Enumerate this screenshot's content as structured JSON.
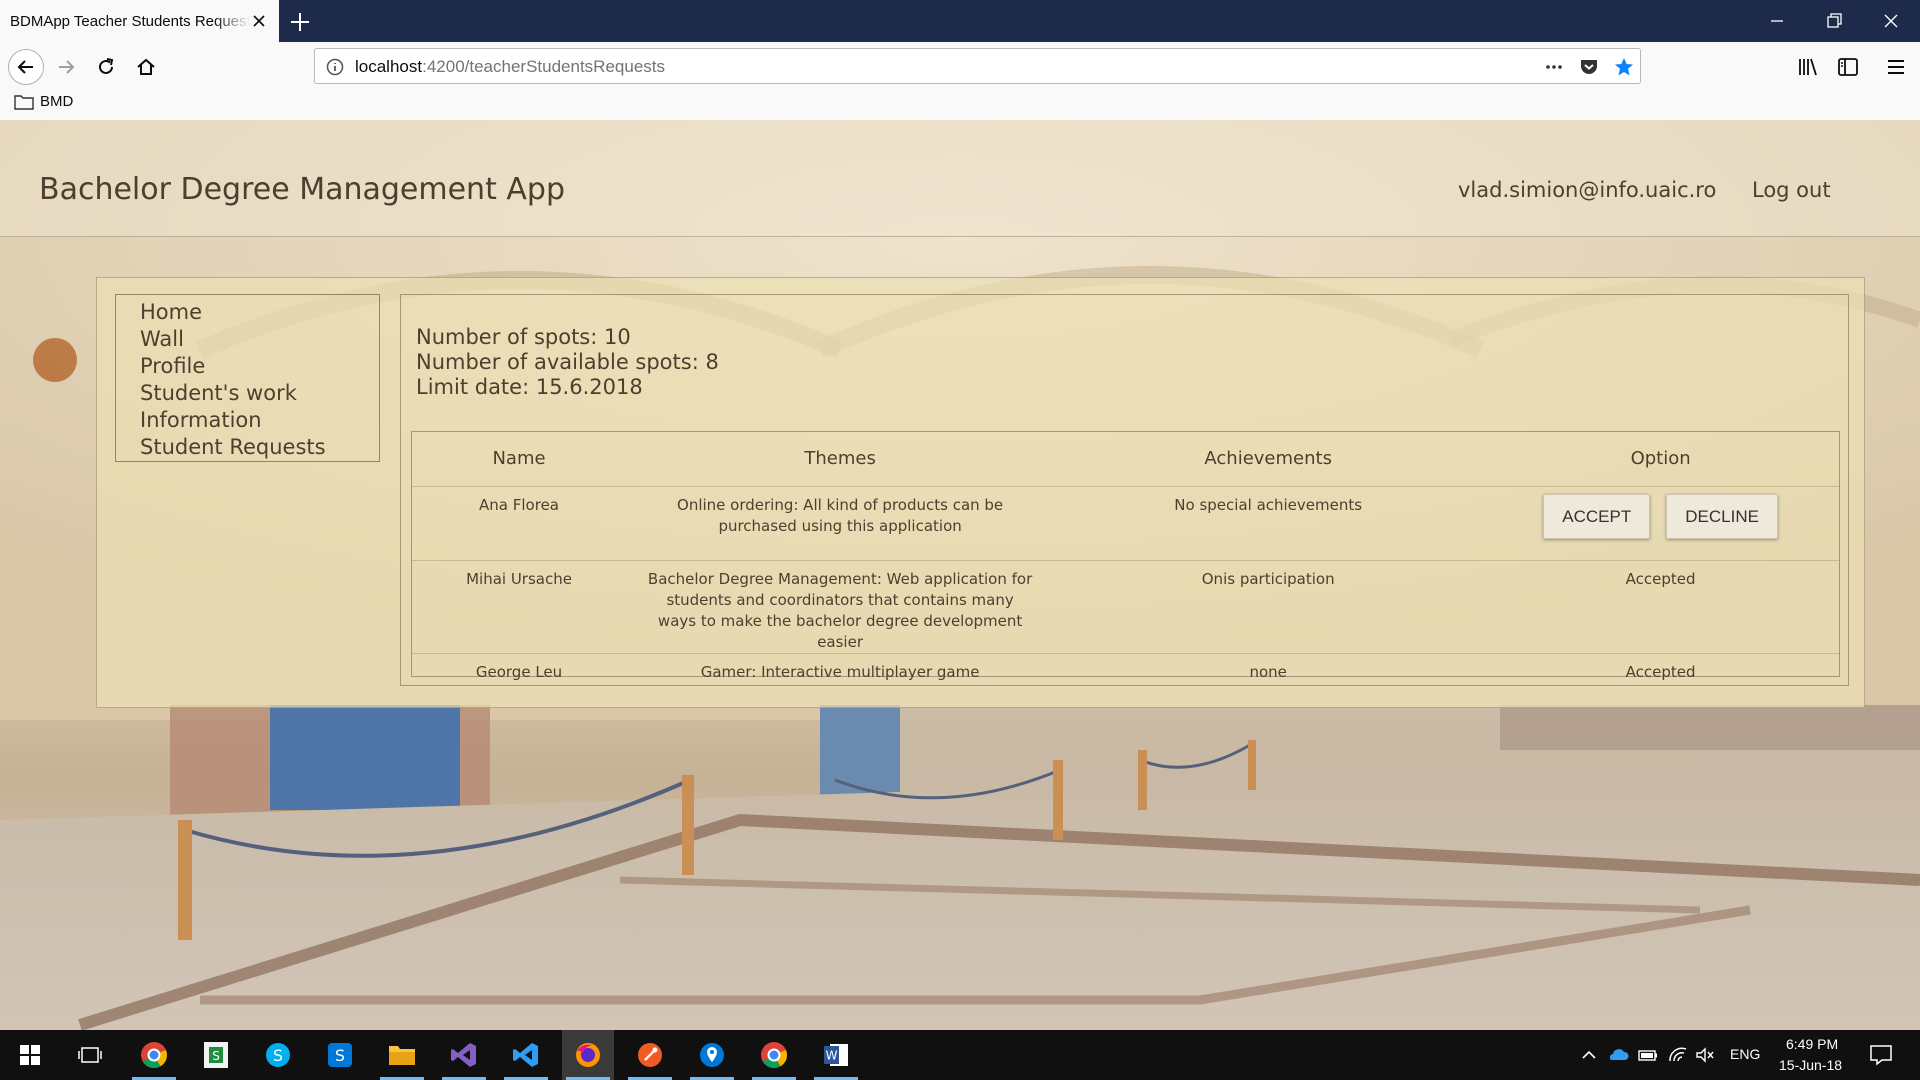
{
  "browser": {
    "tab_title": "BDMApp Teacher Students Requests",
    "url_host": "localhost",
    "url_path": ":4200/teacherStudentsRequests",
    "bookmarks": [
      {
        "label": "BMD",
        "icon": "folder-icon"
      }
    ],
    "toolbar_icons": [
      "back-icon",
      "forward-icon",
      "reload-icon",
      "home-icon",
      "page-actions-icon",
      "pocket-icon",
      "bookmark-star-icon",
      "library-icon",
      "sidebar-icon",
      "menu-icon"
    ]
  },
  "app": {
    "title": "Bachelor Degree Management App",
    "user_email": "vlad.simion@info.uaic.ro",
    "logout_label": "Log out"
  },
  "menu": {
    "items": [
      {
        "label": "Home"
      },
      {
        "label": "Wall"
      },
      {
        "label": "Profile"
      },
      {
        "label": "Student's work"
      },
      {
        "label": "Information"
      },
      {
        "label": "Student Requests"
      }
    ]
  },
  "spots": {
    "total": "Number of spots: 10",
    "available": "Number of available spots: 8",
    "limit_date": "Limit date: 15.6.2018"
  },
  "table": {
    "headers": {
      "name": "Name",
      "themes": "Themes",
      "achievements": "Achievements",
      "option": "Option"
    },
    "rows": [
      {
        "name": "Ana Florea",
        "theme": "Online ordering: All kind of products can be purchased using this application",
        "achievements": "No special achievements",
        "status": "",
        "accept_label": "ACCEPT",
        "decline_label": "DECLINE"
      },
      {
        "name": "Mihai Ursache",
        "theme": "Bachelor Degree Management: Web application for students and coordinators that contains many ways to make the bachelor degree development easier",
        "achievements": "Onis participation",
        "status": "Accepted"
      },
      {
        "name": "George Leu",
        "theme": "Gamer: Interactive multiplayer game",
        "achievements": "none",
        "status": "Accepted"
      }
    ]
  },
  "taskbar": {
    "apps": [
      "windows-start-icon",
      "task-view-icon",
      "chrome-icon",
      "smartsheet-icon",
      "skype-icon",
      "skype-business-icon",
      "file-explorer-icon",
      "visual-studio-icon",
      "vscode-icon",
      "firefox-icon",
      "postman-icon",
      "maps-icon",
      "chrome-icon",
      "word-icon"
    ],
    "language": "ENG",
    "time": "6:49 PM",
    "date": "15-Jun-18"
  },
  "colors": {
    "tabbar": "#1d2a4a",
    "text_brown": "#4f3e2e",
    "panel": "#ebe0b4",
    "taskbar": "#101010",
    "star_blue": "#0a84ff"
  }
}
